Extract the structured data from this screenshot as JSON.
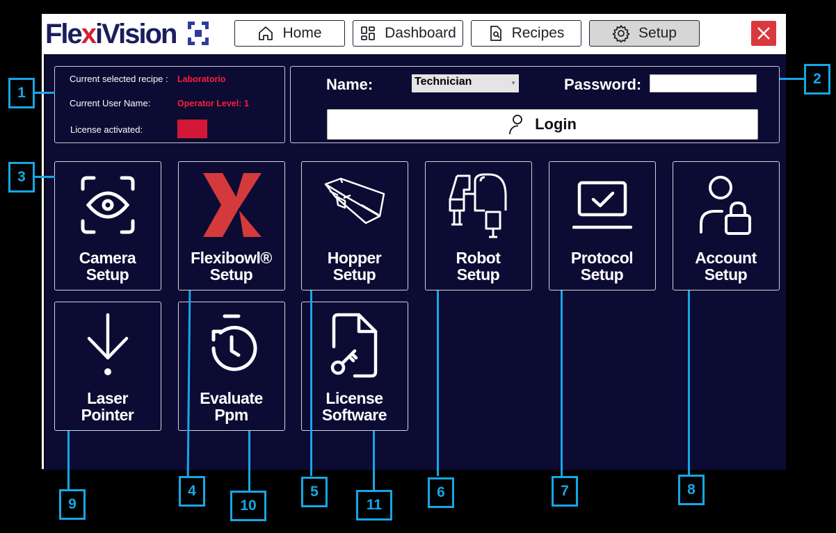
{
  "header": {
    "logo_prefix": "Fle",
    "logo_x": "x",
    "logo_suffix": "iVision",
    "nav": [
      {
        "label": "Home",
        "icon": "home-icon"
      },
      {
        "label": "Dashboard",
        "icon": "dashboard-icon"
      },
      {
        "label": "Recipes",
        "icon": "recipes-icon"
      },
      {
        "label": "Setup",
        "icon": "gear-icon",
        "active": true
      }
    ],
    "close_icon": "close-icon"
  },
  "info": {
    "recipe_label": "Current selected recipe :",
    "recipe_value": "Laboratorio",
    "user_label": "Current User Name:",
    "user_value": "Operator Level: 1",
    "license_label": "License activated:",
    "license_color": "#d21737"
  },
  "login": {
    "name_label": "Name:",
    "name_value": "Technician",
    "password_label": "Password:",
    "password_value": "",
    "login_label": "Login"
  },
  "tiles": [
    {
      "line1": "Camera",
      "line2": "Setup",
      "icon": "camera-eye-icon"
    },
    {
      "line1": "Flexibowl®",
      "line2": "Setup",
      "icon": "flexibowl-logo-icon"
    },
    {
      "line1": "Hopper",
      "line2": "Setup",
      "icon": "hopper-icon"
    },
    {
      "line1": "Robot",
      "line2": "Setup",
      "icon": "robot-arm-icon"
    },
    {
      "line1": "Protocol",
      "line2": "Setup",
      "icon": "laptop-check-icon"
    },
    {
      "line1": "Account",
      "line2": "Setup",
      "icon": "user-lock-icon"
    },
    {
      "line1": "Laser",
      "line2": "Pointer",
      "icon": "laser-pointer-icon"
    },
    {
      "line1": "Evaluate",
      "line2": "Ppm",
      "icon": "stopwatch-icon"
    },
    {
      "line1": "License",
      "line2": "Software",
      "icon": "file-key-icon"
    }
  ],
  "callouts": [
    "1",
    "2",
    "3",
    "4",
    "5",
    "6",
    "7",
    "8",
    "9",
    "10",
    "11"
  ],
  "colors": {
    "panel_bg": "#0c0b33",
    "accent_red": "#d32230",
    "callout_blue": "#16a7e6",
    "close_red": "#d8393d"
  }
}
